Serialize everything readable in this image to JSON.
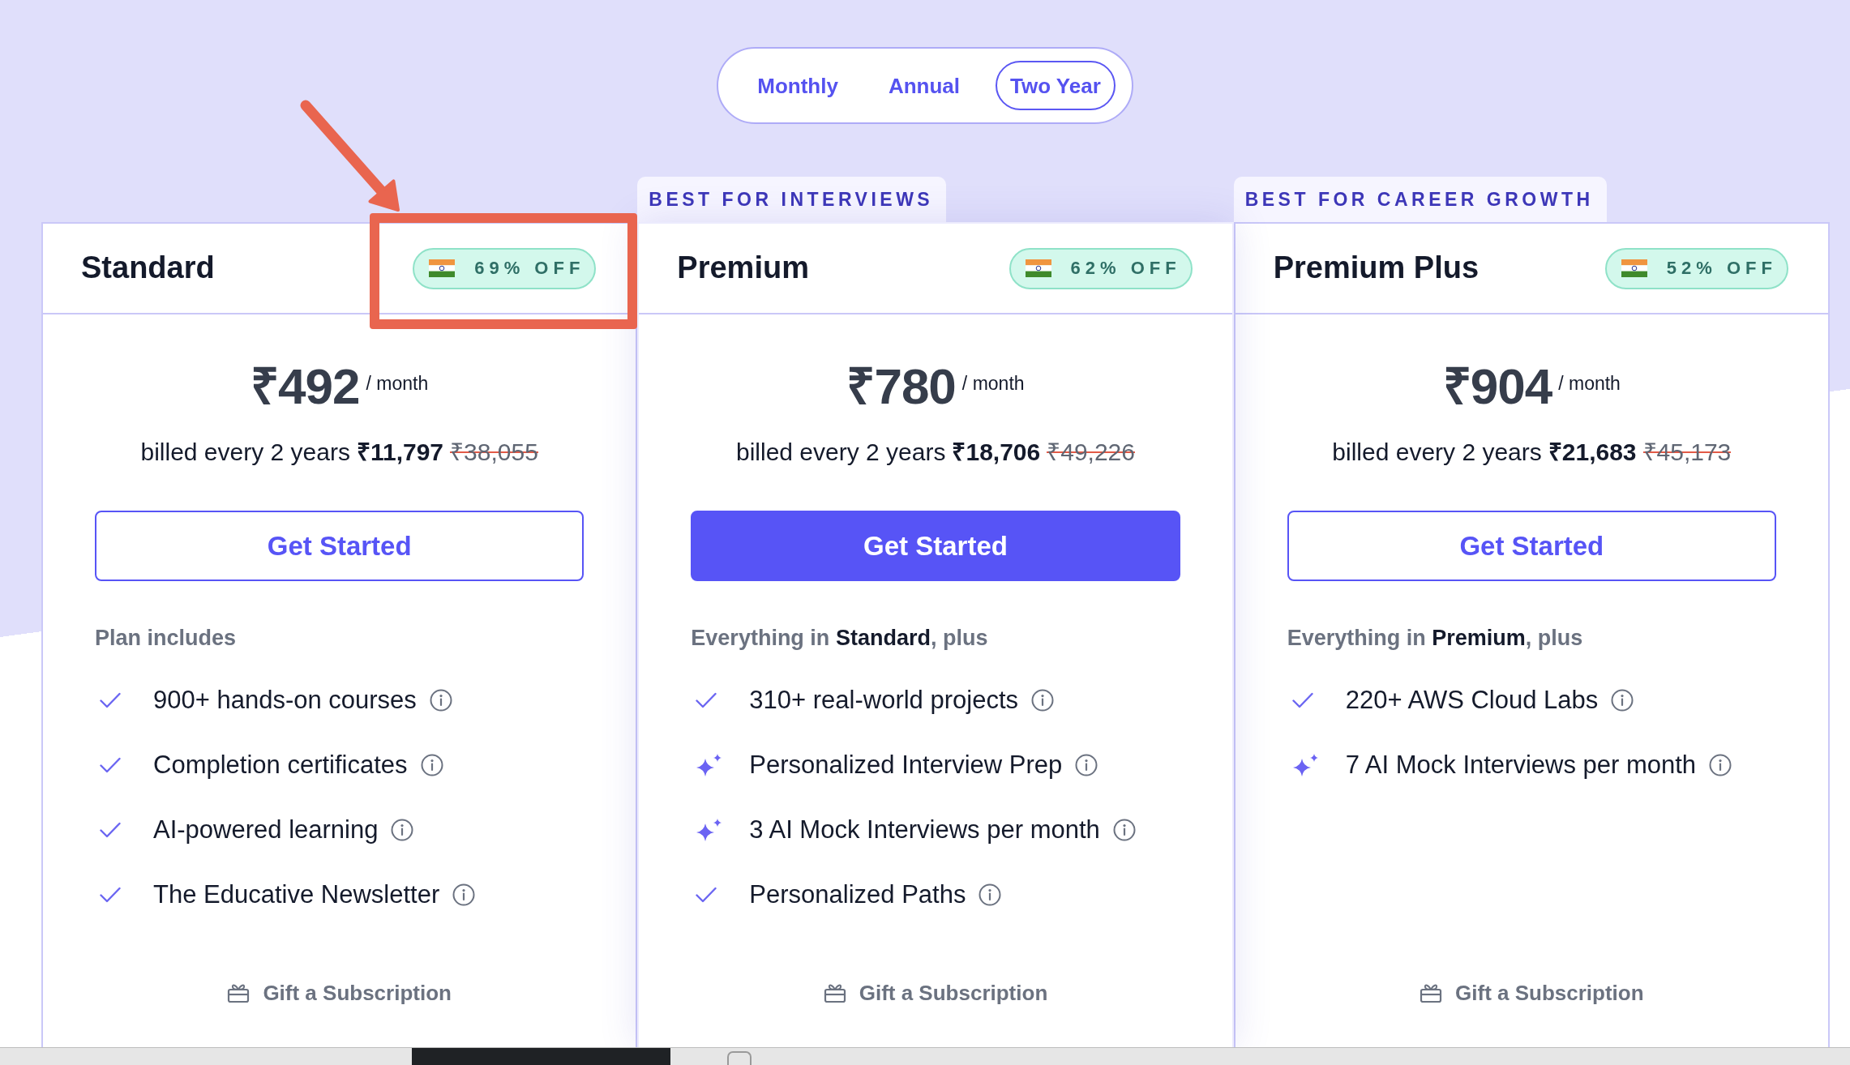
{
  "billing_toggle": [
    {
      "label": "Monthly",
      "selected": false
    },
    {
      "label": "Annual",
      "selected": false
    },
    {
      "label": "Two Year",
      "selected": true
    }
  ],
  "plans": [
    {
      "name": "Standard",
      "discount": "69% OFF",
      "badge_highlighted": true,
      "featured": false,
      "price": "₹492",
      "period": "/ month",
      "billing_note": "billed every 2 years",
      "total_price": "₹11,797",
      "original_price": "₹38,055",
      "button": "Get Started",
      "intro": "Plan includes",
      "features": [
        {
          "kind": "check",
          "text": "900+ hands-on courses"
        },
        {
          "kind": "check",
          "text": "Completion certificates"
        },
        {
          "kind": "check",
          "text": "AI-powered learning"
        },
        {
          "kind": "check",
          "text": "The Educative Newsletter"
        }
      ],
      "gift": "Gift a Subscription"
    },
    {
      "ribbon": "BEST FOR INTERVIEWS",
      "name": "Premium",
      "discount": "62% OFF",
      "badge_highlighted": false,
      "featured": true,
      "price": "₹780",
      "period": "/ month",
      "billing_note": "billed every 2 years",
      "total_price": "₹18,706",
      "original_price": "₹49,226",
      "button": "Get Started",
      "intro": "Everything in **Standard**, plus",
      "features": [
        {
          "kind": "check",
          "text": "310+ real-world projects"
        },
        {
          "kind": "sparkle",
          "text": "Personalized Interview Prep"
        },
        {
          "kind": "sparkle",
          "text": "3 AI Mock Interviews per month"
        },
        {
          "kind": "check",
          "text": "Personalized Paths"
        }
      ],
      "gift": "Gift a Subscription"
    },
    {
      "ribbon": "BEST FOR CAREER GROWTH",
      "name": "Premium Plus",
      "discount": "52% OFF",
      "badge_highlighted": false,
      "featured": false,
      "price": "₹904",
      "period": "/ month",
      "billing_note": "billed every 2 years",
      "total_price": "₹21,683",
      "original_price": "₹45,173",
      "button": "Get Started",
      "intro": "Everything in **Premium**, plus",
      "features": [
        {
          "kind": "check",
          "text": "220+ AWS Cloud Labs"
        },
        {
          "kind": "sparkle",
          "text": "7 AI Mock Interviews per month"
        }
      ],
      "gift": "Gift a Subscription"
    }
  ]
}
